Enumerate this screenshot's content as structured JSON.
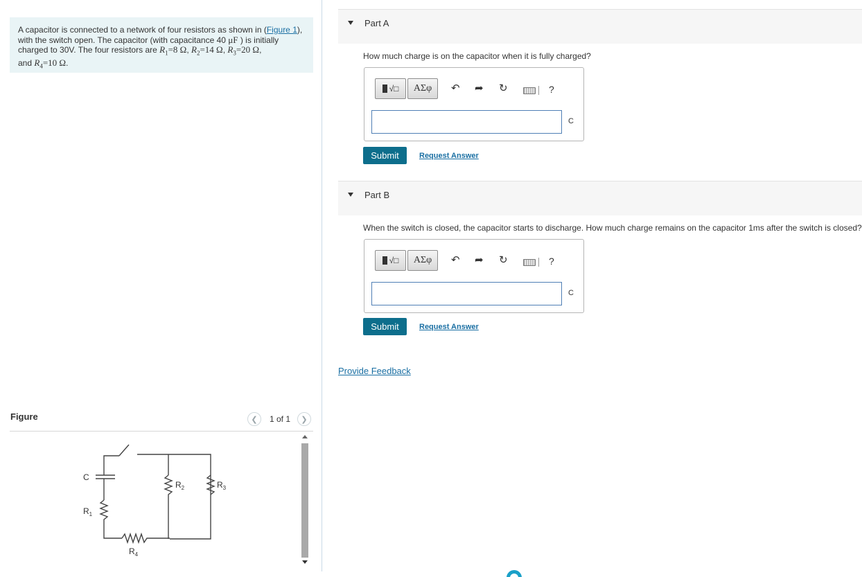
{
  "problem": {
    "text_1": "A capacitor is connected to a network of four resistors as shown in (",
    "figure_link": "Figure 1",
    "text_2": "),",
    "text_3": "with the switch open.  The capacitor (with capacitance 40 ",
    "cap_unit": "μF",
    "text_4": " ) is initially",
    "text_5": "charged to 30V.  The four resistors are ",
    "r1": "R",
    "r1_sub": "1",
    "r1_val": "=8 Ω",
    "r2": "R",
    "r2_sub": "2",
    "r2_val": "=14 Ω",
    "r3": "R",
    "r3_sub": "3",
    "r3_val": "=20 Ω",
    "text_6": "and ",
    "r4": "R",
    "r4_sub": "4",
    "r4_val": "=10 Ω",
    "period": "."
  },
  "figure": {
    "label": "Figure",
    "counter": "1 of 1",
    "circuit_labels": {
      "c": "C",
      "r1": "R",
      "r1_sub": "1",
      "r2": "R",
      "r2_sub": "2",
      "r3": "R",
      "r3_sub": "3",
      "r4": "R",
      "r4_sub": "4"
    }
  },
  "parts": [
    {
      "title": "Part A",
      "question": "How much charge is on the capacitor when it is fully charged?",
      "unit": "C",
      "input_value": "",
      "submit_label": "Submit",
      "request_label": "Request Answer"
    },
    {
      "title": "Part B",
      "question": "When the switch is closed, the capacitor starts to discharge.  How much charge remains on the capacitor 1ms after the switch is closed?",
      "unit": "C",
      "input_value": "",
      "submit_label": "Submit",
      "request_label": "Request Answer"
    }
  ],
  "toolbar": {
    "greek_label": "ΑΣφ",
    "help_label": "?"
  },
  "feedback_label": "Provide Feedback",
  "icons": [
    "templates-icon",
    "greek-icon",
    "undo-icon",
    "redo-icon",
    "reset-icon",
    "keyboard-icon",
    "help-icon",
    "chevron-left-icon",
    "chevron-right-icon",
    "caret-down-icon"
  ]
}
